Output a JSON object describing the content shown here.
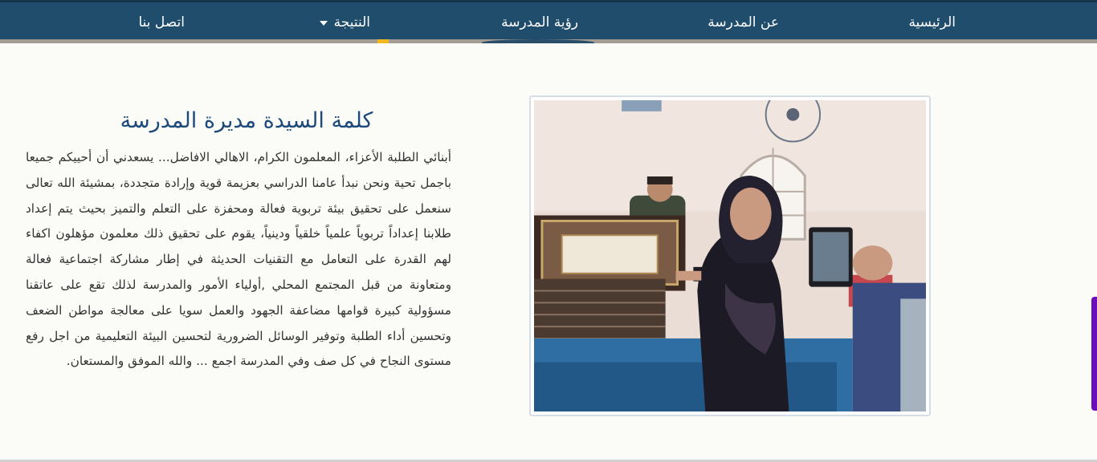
{
  "nav": {
    "home": "الرئيسية",
    "about": "عن المدرسة",
    "vision": "رؤية المدرسة",
    "result": "النتيجة",
    "contact": "اتصل بنا"
  },
  "article": {
    "title": "كلمة السيدة مديرة المدرسة",
    "body": "أبنائي الطلبة الأعزاء، المعلمون الكرام، الاهالي الافاضل... يسعدني أن أحييكم جميعا باجمل تحية ونحن نبدأ عامنا الدراسي بعزيمة قوية وإرادة متجددة، بمشيئة الله تعالى سنعمل على تحقيق بيئة تربوية فعالة ومحفزة على التعلم والتميز بحيث يتم إعداد طلابنا إعداداً تربوياً علمياً خلقياً ودينياً، يقوم على تحقيق ذلك معلمون مؤهلون اكفاء لهم القدرة على التعامل مع التقنيات الحديثة في إطار مشاركة اجتماعية فعالة ومتعاونة من قبل المجتمع المحلي ,أولياء الأمور والمدرسة لذلك تقع على عاتقنا مسؤولية كبيرة قوامها مضاعفة الجهود والعمل سويا على معالجة مواطن الضعف وتحسين أداء الطلبة وتوفير الوسائل الضرورية لتحسين البيئة التعليمية من اجل رفع مستوى النجاح في كل صف وفي المدرسة اجمع ... والله الموفق والمستعان."
  },
  "colors": {
    "nav_bg": "#1f4d6b",
    "title": "#1d4a7a",
    "accent_yellow": "#f2b91d",
    "scroll_accent": "#6a0dbb"
  }
}
